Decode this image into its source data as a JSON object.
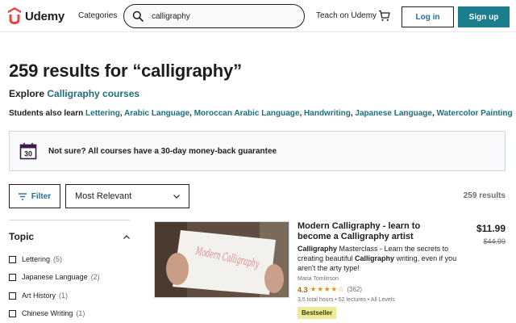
{
  "header": {
    "logo_text": "Udemy",
    "categories": "Categories",
    "search_value": "calligraphy",
    "teach": "Teach on Udemy",
    "login": "Log in",
    "signup": "Sign up"
  },
  "main": {
    "results_title": "259 results for “calligraphy”",
    "explore_prefix": "Explore ",
    "explore_link": "Calligraphy courses",
    "also_learn_prefix": "Students also learn ",
    "also_learn": [
      "Lettering",
      "Arabic Language",
      "Moroccan Arabic Language",
      "Handwriting",
      "Japanese Language",
      "Watercolor Painting"
    ],
    "guarantee_day": "30",
    "guarantee_text": "Not sure? All courses have a 30-day money-back guarantee",
    "filter_label": "Filter",
    "sort_value": "Most Relevant",
    "results_count": "259 results"
  },
  "sidebar": {
    "topic_title": "Topic",
    "items": [
      {
        "label": "Lettering",
        "count": "(5)"
      },
      {
        "label": "Japanese Language",
        "count": "(2)"
      },
      {
        "label": "Art History",
        "count": "(1)"
      },
      {
        "label": "Chinese Writing",
        "count": "(1)"
      }
    ]
  },
  "course": {
    "title": "Modern Calligraphy - learn to become a Calligraphy artist",
    "desc_parts": [
      "Calligraphy",
      " Masterclass - Learn the secrets to creating beautiful ",
      "Calligraphy",
      " writing, even if you aren't the arty type!"
    ],
    "author": "Maria Tomlinson",
    "rating": "4.3",
    "rating_value": 4.3,
    "rating_count": "(362)",
    "meta": "3.5 total hours • 52 lectures • All Levels",
    "badge": "Bestseller",
    "price": "$11.99",
    "old_price": "$44.99",
    "thumb_text": "Modern Calligraphy"
  },
  "colors": {
    "brand": "#a435f0",
    "teal": "#1c7d8c",
    "link": "#1c6f80",
    "star": "#e59819",
    "bestseller_bg": "#eceb98"
  }
}
